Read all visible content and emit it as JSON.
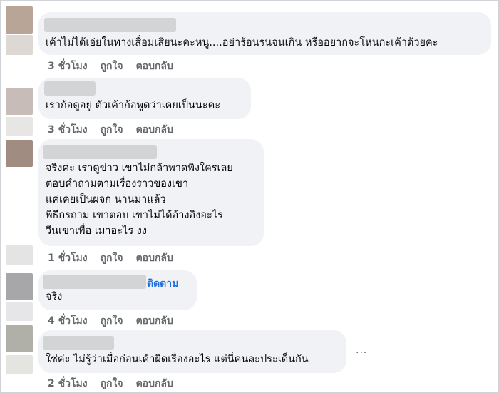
{
  "comments": [
    {
      "text": "เค้าไม่ได้เอ่ยในทางเสื่อมเสียนะคะหนู....อย่าร้อนรนจนเกิน หรืออยากจะโหนกะเค้าด้วยคะ",
      "time": "3 ชั่วโมง",
      "like": "ถูกใจ",
      "reply": "ตอบกลับ",
      "avatar_color": "#b9a597"
    },
    {
      "text": "เราก้อดูอยู่ ตัวเค้าก้อพูดว่าเคยเป็นนะคะ",
      "time": "3 ชั่วโมง",
      "like": "ถูกใจ",
      "reply": "ตอบกลับ",
      "avatar_color": "#c8bcb8"
    },
    {
      "text": "จริงค่ะ เราดูข่าว เขาไม่กล้าพาดพิงใครเลย\nตอบคำถามตามเรื่องราวของเขา\nแค่เคยเป็นผจก นานมาแล้ว\nพิธีกรถาม เขาตอบ เขาไม่ได้อ้างอิงอะไร\nวีนเขาเพื่อ เมาอะไร งง",
      "time": "1 ชั่วโมง",
      "like": "ถูกใจ",
      "reply": "ตอบกลับ",
      "avatar_color": "#a08c80"
    },
    {
      "text": "จริง",
      "follow": "ติดตาม",
      "time": "4 ชั่วโมง",
      "like": "ถูกใจ",
      "reply": "ตอบกลับ",
      "avatar_color": "#a7a7a9"
    },
    {
      "text": "ใช่ค่ะ ไม่รู้ว่าเมื่อก่อนเค้าผิดเรื่องอะไร แต่นี่คนละประเด็นกัน",
      "more": "...",
      "time": "2 ชั่วโมง",
      "like": "ถูกใจ",
      "reply": "ตอบกลับ",
      "avatar_color": "#b0b0a8"
    }
  ]
}
